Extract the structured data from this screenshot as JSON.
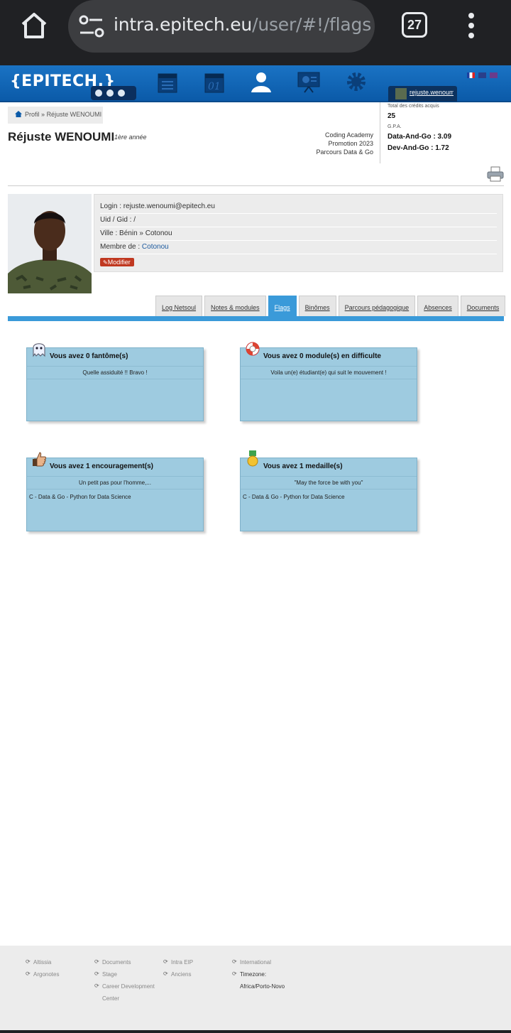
{
  "browser": {
    "url_host": "intra.epitech.eu",
    "url_path": "/user/#!/flags",
    "tab_count": "27"
  },
  "header": {
    "logo": "{EPITECH.}",
    "nav": [
      "calendar-icon",
      "planning-icon",
      "profile-icon",
      "modules-icon",
      "admin-icon"
    ],
    "user_login": "rejuste.wenoumi"
  },
  "breadcrumb": {
    "root": "Profil",
    "sep": "»",
    "current": "Réjuste WENOUMI"
  },
  "profile": {
    "name": "Réjuste WENOUMI",
    "year": "1ère année",
    "school": "Coding Academy",
    "promo": "Promotion 2023",
    "course": "Parcours Data & Go",
    "login_line": "Login : rejuste.wenoumi@epitech.eu",
    "uid_line": "Uid / Gid : /",
    "ville_line": "Ville : Bénin » Cotonou",
    "member_label": "Membre de : ",
    "member_link": "Cotonou",
    "modify_label": "Modifier"
  },
  "credits": {
    "total_label": "Total des crédits acquis",
    "total_value": "25",
    "gpa_label": "G.P.A.",
    "gpa_1": "Data-And-Go : 3.09",
    "gpa_2": "Dev-And-Go : 1.72"
  },
  "tabs": [
    {
      "label": "Log Netsoul"
    },
    {
      "label": "Notes & modules"
    },
    {
      "label": "Flags"
    },
    {
      "label": "Binômes"
    },
    {
      "label": "Parcours pédagogique"
    },
    {
      "label": "Absences"
    },
    {
      "label": "Documents"
    }
  ],
  "active_tab": "Flags",
  "flags": {
    "ghost": {
      "title": "Vous avez 0 fantôme(s)",
      "subtitle": "Quelle assiduité !! Bravo !",
      "item": ""
    },
    "difficulty": {
      "title": "Vous avez 0 module(s) en difficulte",
      "subtitle": "Voila un(e) étudiant(e) qui suit le mouvement !",
      "item": ""
    },
    "encouragement": {
      "title": "Vous avez 1 encouragement(s)",
      "subtitle": "Un petit pas pour l'homme,...",
      "item": "C - Data & Go - Python for Data Science"
    },
    "medal": {
      "title": "Vous avez 1 medaille(s)",
      "subtitle": "\"May the force be with you\"",
      "item": "C - Data & Go - Python for Data Science"
    }
  },
  "footer": {
    "col1": [
      "Altissia",
      "Argonotes"
    ],
    "col2": [
      "Documents",
      "Stage",
      "Career Development",
      "Center"
    ],
    "col3": [
      "Intra EIP",
      "Anciens"
    ],
    "col4": [
      "International",
      "Timezone:",
      "Africa/Porto-Novo"
    ]
  },
  "colors": {
    "header_blue": "#0b5aa8",
    "tab_active": "#3a9ad9",
    "card_bg": "#9ecbe0",
    "modify_red": "#c03820"
  }
}
